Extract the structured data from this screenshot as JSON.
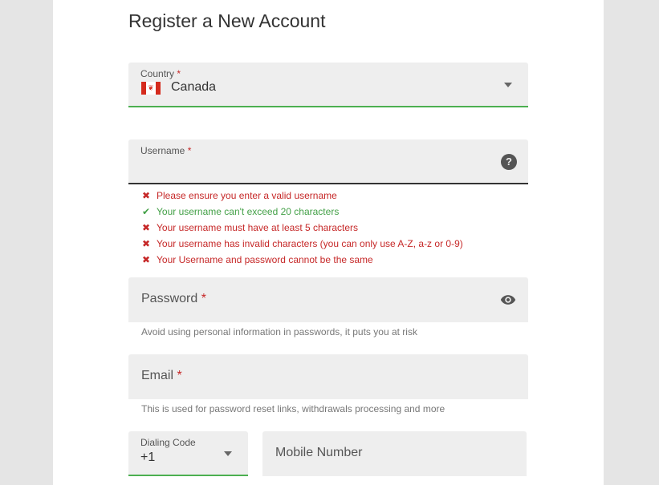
{
  "form": {
    "title": "Register a New Account",
    "country": {
      "label": "Country",
      "required_mark": "*",
      "value": "Canada",
      "flag_glyph": "❦"
    },
    "username": {
      "label": "Username",
      "required_mark": "*",
      "help_glyph": "?",
      "rules": [
        {
          "status": "fail",
          "glyph": "✖",
          "text": "Please ensure you enter a valid username"
        },
        {
          "status": "pass",
          "glyph": "✔",
          "text": "Your username can't exceed 20 characters"
        },
        {
          "status": "fail",
          "glyph": "✖",
          "text": "Your username must have at least 5 characters"
        },
        {
          "status": "fail",
          "glyph": "✖",
          "text": "Your username has invalid characters (you can only use A-Z, a-z or 0-9)"
        },
        {
          "status": "fail",
          "glyph": "✖",
          "text": "Your Username and password cannot be the same"
        }
      ]
    },
    "password": {
      "label": "Password",
      "required_mark": "*",
      "hint": "Avoid using personal information in passwords, it puts you at risk"
    },
    "email": {
      "label": "Email",
      "required_mark": "*",
      "hint": "This is used for password reset links, withdrawals processing and more"
    },
    "dialing_code": {
      "label": "Dialing Code",
      "value": "+1"
    },
    "mobile": {
      "label": "Mobile Number"
    }
  },
  "colors": {
    "page_bg": "#e5e5e5",
    "field_bg": "#eeeeee",
    "valid_green": "#4caf50",
    "error_red": "#c62828",
    "pass_green": "#43a047"
  }
}
